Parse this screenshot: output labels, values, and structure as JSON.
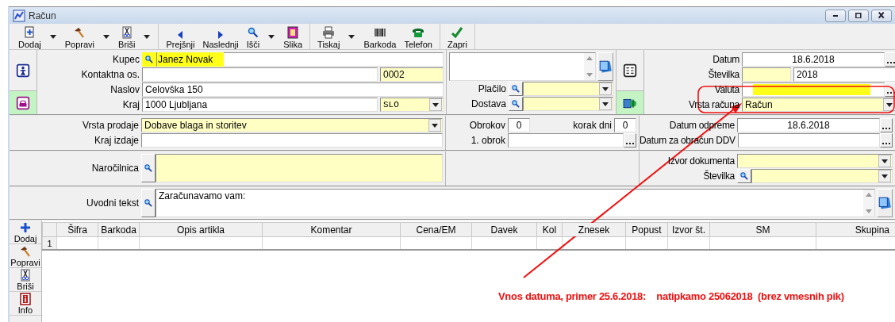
{
  "window": {
    "title": "Račun"
  },
  "toolbar": {
    "groups": [
      [
        {
          "label": "Dodaj",
          "menu": true
        },
        {
          "label": "Popravi",
          "menu": true
        },
        {
          "label": "Briši",
          "menu": true
        }
      ],
      [
        {
          "label": "Prejšnji",
          "menu": false
        },
        {
          "label": "Naslednji",
          "menu": false
        },
        {
          "label": "Išči",
          "menu": true
        },
        {
          "label": "Slika",
          "menu": false
        }
      ],
      [
        {
          "label": "Tiskaj",
          "menu": true
        },
        {
          "label": "Barkoda",
          "menu": false
        },
        {
          "label": "Telefon",
          "menu": false
        }
      ],
      [
        {
          "label": "Zapri",
          "menu": false
        }
      ]
    ]
  },
  "sections": [
    {
      "kind": "with_strips",
      "left": {
        "rows": [
          {
            "label": "Kupec",
            "fields": [
              {
                "kind": "lookup",
                "value": "Janez Novak",
                "required": false,
                "highlighted": true
              }
            ]
          },
          {
            "label": "Kontaktna os.",
            "fields": [
              {
                "kind": "text",
                "required": false
              },
              {
                "kind": "text",
                "value": "0002",
                "required": true,
                "short": true
              }
            ]
          },
          {
            "label": "Naslov",
            "fields": [
              {
                "kind": "text",
                "value": "Celovška 150",
                "required": false
              }
            ]
          },
          {
            "label": "Kraj",
            "fields": [
              {
                "kind": "text",
                "value": "1000 Ljubljana",
                "required": false
              },
              {
                "kind": "combo",
                "value": "SLO",
                "required": true,
                "short": true
              }
            ]
          }
        ]
      },
      "middle": {
        "rows": [
          {
            "fields": [
              {
                "kind": "notes",
                "required": false
              }
            ]
          },
          {
            "label": "Plačilo",
            "fields": [
              {
                "kind": "lookup_combo",
                "required": true
              }
            ]
          },
          {
            "label": "Dostava",
            "fields": [
              {
                "kind": "lookup_combo",
                "required": true
              }
            ]
          }
        ]
      },
      "right": {
        "rows": [
          {
            "label": "Datum",
            "fields": [
              {
                "kind": "date",
                "value": "18.6.2018",
                "required": false
              }
            ]
          },
          {
            "label": "Številka",
            "fields": [
              {
                "kind": "text",
                "required": true,
                "short": true
              },
              {
                "kind": "text",
                "value": "2018",
                "required": false
              }
            ]
          },
          {
            "label": "Valuta",
            "fields": [
              {
                "kind": "picker",
                "required": false,
                "highlighted": true
              }
            ]
          },
          {
            "label": "Vrsta računa",
            "fields": [
              {
                "kind": "combo",
                "value": "Račun",
                "required": true
              }
            ]
          }
        ]
      }
    },
    {
      "kind": "plain",
      "left": {
        "rows": [
          {
            "label": "Vrsta prodaje",
            "fields": [
              {
                "kind": "combo",
                "value": "Dobave blaga in storitev",
                "required": true
              }
            ]
          },
          {
            "label": "Kraj izdaje",
            "fields": [
              {
                "kind": "text",
                "required": false
              }
            ]
          }
        ]
      },
      "middle": {
        "rows": [
          {
            "label": "Obrokov",
            "fields": [
              {
                "kind": "number",
                "value": "0",
                "required": false
              },
              {
                "label": "korak dni",
                "kind": "number",
                "value": "0",
                "required": false
              }
            ]
          },
          {
            "label": "1. obrok",
            "fields": [
              {
                "kind": "date",
                "required": false
              }
            ]
          }
        ]
      },
      "right": {
        "rows": [
          {
            "label": "Datum odpreme",
            "fields": [
              {
                "kind": "date",
                "value": "18.6.2018",
                "required": false
              }
            ]
          },
          {
            "label": "Datum za obračun DDV",
            "fields": [
              {
                "kind": "date",
                "required": false
              }
            ]
          }
        ]
      }
    },
    {
      "kind": "plain",
      "left": {
        "rows": [
          {
            "label": "Naročilnica",
            "fields": [
              {
                "kind": "lookup_memo",
                "required": true
              }
            ]
          }
        ]
      },
      "right": {
        "rows": [
          {
            "label": "Izvor dokumenta",
            "fields": [
              {
                "kind": "combo",
                "required": true
              }
            ]
          },
          {
            "label": "Številka",
            "fields": [
              {
                "kind": "lookup_combo",
                "required": true
              }
            ]
          }
        ]
      }
    },
    {
      "kind": "full",
      "left": {
        "rows": [
          {
            "label": "Uvodni tekst",
            "fields": [
              {
                "kind": "lookup_notes",
                "value": "Zaračunavamo vam:",
                "required": false
              }
            ]
          }
        ]
      }
    }
  ],
  "items": {
    "actions": [
      {
        "label": "Dodaj"
      },
      {
        "label": "Popravi"
      },
      {
        "label": "Briši"
      },
      {
        "label": "Info"
      }
    ],
    "columns": [
      "Šifra",
      "Barkoda",
      "Opis artikla",
      "Komentar",
      "Cena/EM",
      "Davek",
      "Kol",
      "Znesek",
      "Popust",
      "Izvor št.",
      "SM",
      "Skupina"
    ],
    "rows": [
      {
        "number": "1"
      }
    ]
  },
  "callout": {
    "text": "Vnos datuma, primer 25.6.2018:    natipkamo 25062018  (brez vmesnih pik)"
  }
}
